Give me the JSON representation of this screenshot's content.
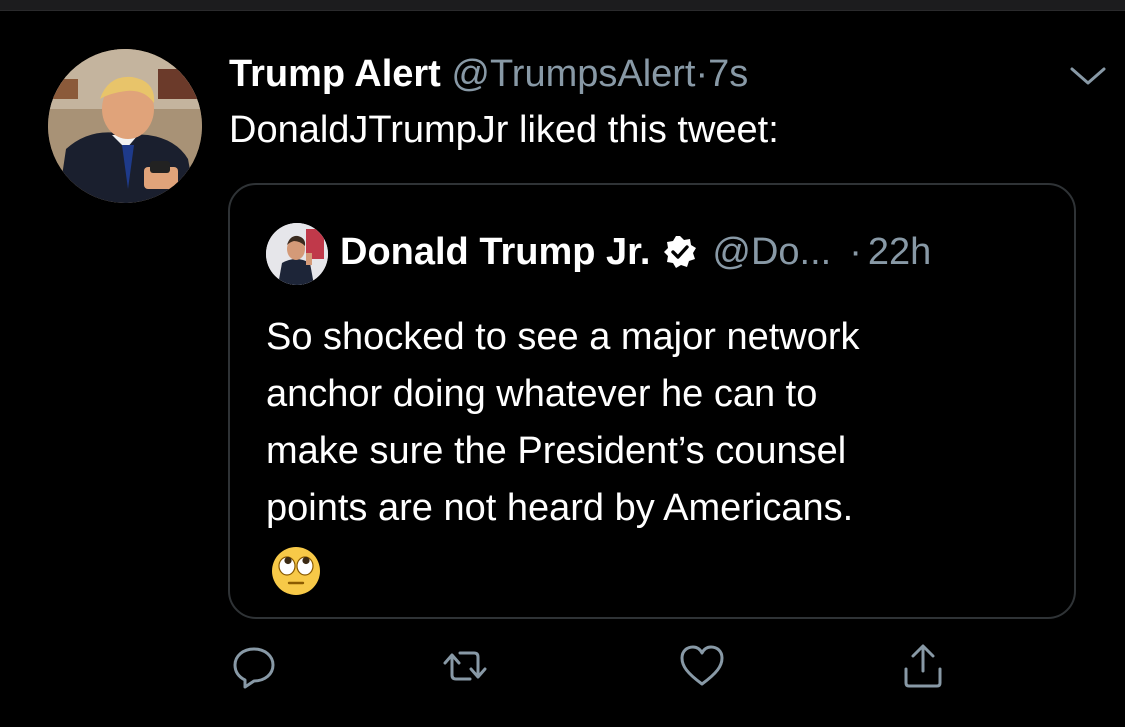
{
  "tweet": {
    "author_name": "Trump Alert",
    "author_handle": "@TrumpsAlert",
    "separator": "·",
    "time": "7s",
    "text": "DonaldJTrumpJr liked this tweet:",
    "menu_icon": "chevron-down-icon"
  },
  "quoted": {
    "author_name": "Donald Trump Jr.",
    "verified_icon": "verified-badge-icon",
    "author_handle": "@Do...",
    "separator": "·",
    "time": "22h",
    "lines": [
      "So shocked to see a major network",
      "anchor doing whatever he can to",
      "make sure the President’s counsel",
      "points are not heard by Americans."
    ],
    "emoji": "face-with-rolling-eyes"
  },
  "actions": [
    {
      "name": "reply",
      "icon": "reply-icon"
    },
    {
      "name": "retweet",
      "icon": "retweet-icon"
    },
    {
      "name": "like",
      "icon": "heart-icon"
    },
    {
      "name": "share",
      "icon": "share-icon"
    }
  ],
  "colors": {
    "background": "#000000",
    "text": "#ffffff",
    "secondary": "#8899a6",
    "border": "#2f3336"
  }
}
